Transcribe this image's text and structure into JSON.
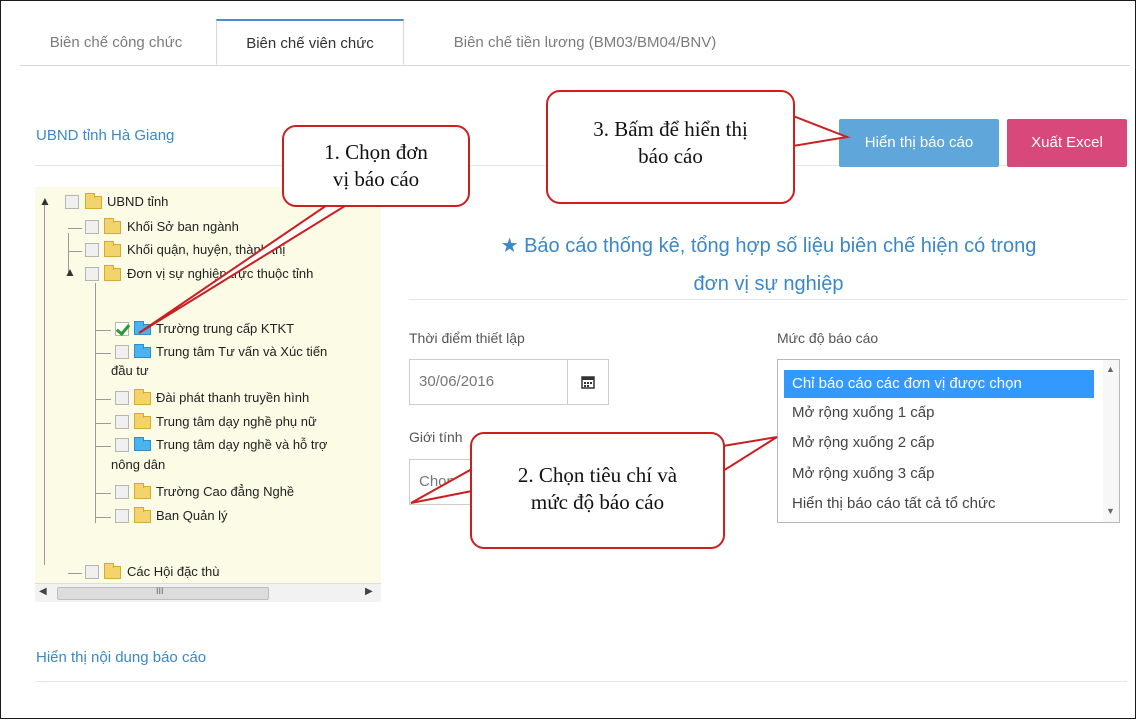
{
  "tabs": [
    {
      "label": "Biên chế công chức",
      "active": false
    },
    {
      "label": "Biên chế viên chức",
      "active": true
    },
    {
      "label": "Biên chế tiền lương (BM03/BM04/BNV)",
      "active": false
    }
  ],
  "org": {
    "selected_label": "UBND tỉnh Hà Giang"
  },
  "actions": {
    "show_report": "Hiển thị báo cáo",
    "export_excel": "Xuất Excel"
  },
  "tree": {
    "root": "UBND tỉnh",
    "items": [
      "Khối Sở ban ngành",
      "Khối quận, huyện, thành thị",
      "Đơn vị sự nghiệp trực thuộc tỉnh",
      "Trường trung cấp KTKT",
      "Trung tâm Tư vấn và Xúc tiến",
      "đầu tư",
      "Đài phát thanh truyền hình",
      "Trung tâm dạy nghề phụ nữ",
      "Trung tâm dạy nghề và hỗ trợ",
      "nông dân",
      "Trường Cao đẳng Nghề",
      "Ban Quản lý",
      "Các Hội đặc thù"
    ],
    "scroll_thumb_glyph": "III"
  },
  "report": {
    "title_line1": "Báo cáo thống kê, tổng hợp số liệu biên chế hiện có trong",
    "title_line2": "đơn vị sự nghiệp"
  },
  "form": {
    "setup_time_label": "Thời điểm thiết lập",
    "setup_time_value": "30/06/2016",
    "gender_label": "Giới tính",
    "gender_value": "Chọn",
    "level_label": "Mức độ báo cáo",
    "level_options": [
      "Chỉ báo cáo các đơn vị được chọn",
      "Mở rộng xuống 1 cấp",
      "Mở rộng xuống 2 cấp",
      "Mở rộng xuống 3 cấp",
      "Hiển thị báo cáo tất cả tổ chức"
    ],
    "level_selected": "Chỉ báo cáo các đơn vị được chọn"
  },
  "content": {
    "heading": "Hiển thị nội dung báo cáo"
  },
  "callouts": {
    "c1_line1": "1. Chọn đơn",
    "c1_line2": "vị báo cáo",
    "c2_line1": "2. Chọn tiêu chí và",
    "c2_line2": "mức độ báo cáo",
    "c3_line1": "3. Bấm để hiển thị",
    "c3_line2": "báo cáo"
  },
  "colors": {
    "accent": "#3a88c8",
    "show_button": "#5fa7db",
    "excel_button": "#d9487a",
    "callout_border": "#cc1f1f",
    "tree_bg": "#fbfbe6"
  }
}
